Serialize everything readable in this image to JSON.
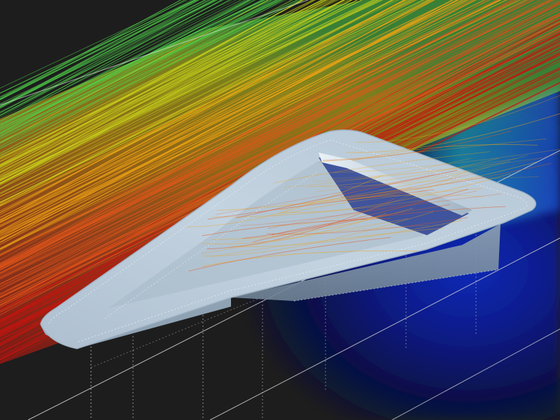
{
  "scene": {
    "background_color": "#1d1d1d",
    "colormap": [
      "#0a1f9e",
      "#1b6fd8",
      "#22c2c8",
      "#4fd14a",
      "#c9d21a",
      "#f0a312",
      "#e4561a",
      "#c8140f"
    ],
    "wing_color": "#b9cbd9",
    "wing_edge_color": "#9fb3c4",
    "grid_line_color": "#d8d8d8",
    "icons": [
      "delta-wing-model",
      "streamlines",
      "flow-field-contour",
      "ground-plane-grid"
    ]
  }
}
